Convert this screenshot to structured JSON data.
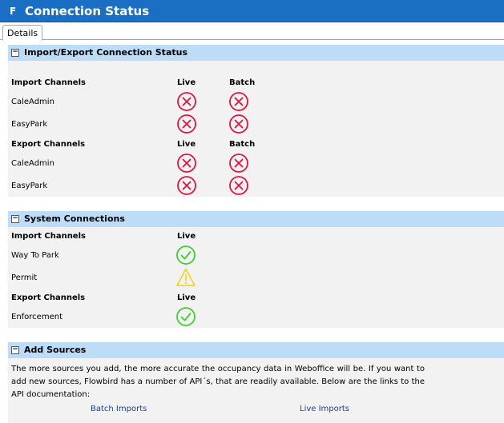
{
  "app": {
    "logo": "F",
    "title": "Connection Status"
  },
  "tabs": [
    {
      "label": "Details"
    }
  ],
  "import_export": {
    "title": "Import/Export Connection Status",
    "toggle": "−",
    "import_header": {
      "label": "Import Channels",
      "live": "Live",
      "batch": "Batch"
    },
    "import_rows": [
      {
        "name": "CaleAdmin",
        "live": "error",
        "batch": "error"
      },
      {
        "name": "EasyPark",
        "live": "error",
        "batch": "error"
      }
    ],
    "export_header": {
      "label": "Export Channels",
      "live": "Live",
      "batch": "Batch"
    },
    "export_rows": [
      {
        "name": "CaleAdmin",
        "live": "error",
        "batch": "error"
      },
      {
        "name": "EasyPark",
        "live": "error",
        "batch": "error"
      }
    ]
  },
  "system": {
    "title": "System Connections",
    "toggle": "−",
    "import_header": {
      "label": "Import Channels",
      "live": "Live"
    },
    "import_rows": [
      {
        "name": "Way To Park",
        "live": "ok"
      },
      {
        "name": "Permit",
        "live": "warning"
      }
    ],
    "export_header": {
      "label": "Export Channels",
      "live": "Live"
    },
    "export_rows": [
      {
        "name": "Enforcement",
        "live": "ok"
      }
    ]
  },
  "sources": {
    "title": "Add Sources",
    "toggle": "−",
    "text": "The more sources you add, the more accurate the occupancy data in Weboffice will be. If you want to add new sources, Flowbird has a number of API´s, that are readily available. Below are the links to the API documentation:",
    "links": {
      "batch": "Batch Imports",
      "live": "Live Imports"
    }
  },
  "colors": {
    "header_bar": "#1a6fc4",
    "section_header": "#bcdcf8",
    "error": "#e0143c",
    "ok": "#3fcf2f",
    "warning": "#f2d21b"
  },
  "icons": {
    "error": "x-circle-icon",
    "ok": "check-circle-icon",
    "warning": "warning-triangle-icon"
  }
}
